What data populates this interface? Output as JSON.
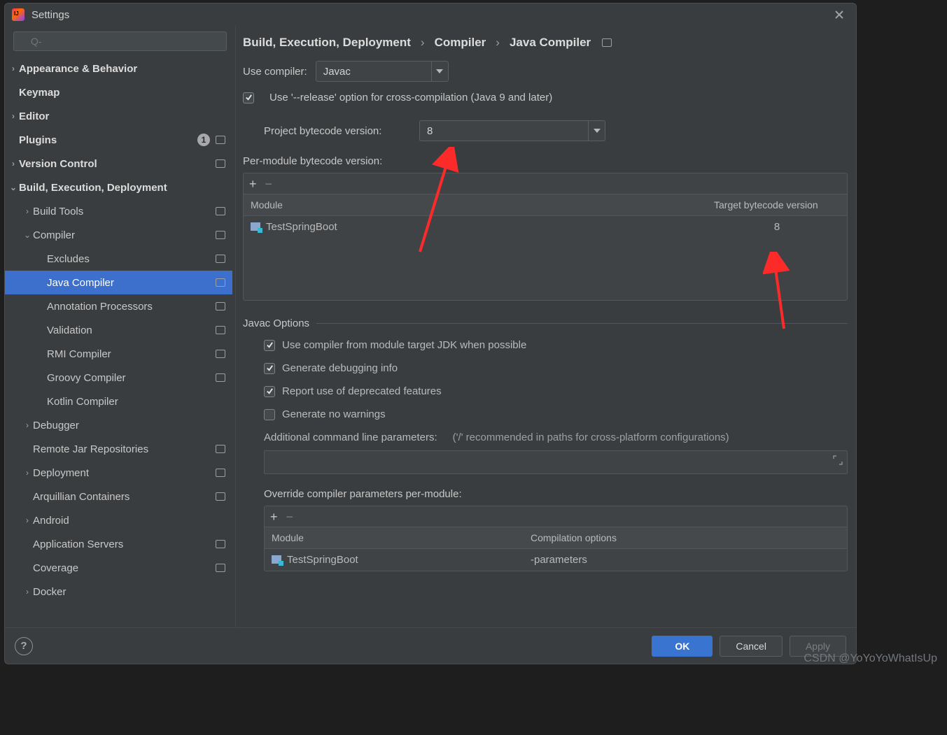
{
  "window": {
    "title": "Settings"
  },
  "search": {
    "placeholder": ""
  },
  "sidebar": {
    "items": [
      {
        "label": "Appearance & Behavior",
        "indent": 0,
        "bold": true,
        "arrow": "right",
        "badge": null
      },
      {
        "label": "Keymap",
        "indent": 0,
        "bold": true,
        "arrow": "",
        "badge": null
      },
      {
        "label": "Editor",
        "indent": 0,
        "bold": true,
        "arrow": "right",
        "badge": null
      },
      {
        "label": "Plugins",
        "indent": 0,
        "bold": true,
        "arrow": "",
        "badge": "1",
        "box": true
      },
      {
        "label": "Version Control",
        "indent": 0,
        "bold": true,
        "arrow": "right",
        "box": true
      },
      {
        "label": "Build, Execution, Deployment",
        "indent": 0,
        "bold": true,
        "arrow": "down"
      },
      {
        "label": "Build Tools",
        "indent": 1,
        "arrow": "right",
        "box": true
      },
      {
        "label": "Compiler",
        "indent": 1,
        "arrow": "down",
        "box": true
      },
      {
        "label": "Excludes",
        "indent": 2,
        "box": true
      },
      {
        "label": "Java Compiler",
        "indent": 2,
        "box": true,
        "selected": true
      },
      {
        "label": "Annotation Processors",
        "indent": 2,
        "box": true
      },
      {
        "label": "Validation",
        "indent": 2,
        "box": true
      },
      {
        "label": "RMI Compiler",
        "indent": 2,
        "box": true
      },
      {
        "label": "Groovy Compiler",
        "indent": 2,
        "box": true
      },
      {
        "label": "Kotlin Compiler",
        "indent": 2
      },
      {
        "label": "Debugger",
        "indent": 1,
        "arrow": "right"
      },
      {
        "label": "Remote Jar Repositories",
        "indent": 1,
        "box": true
      },
      {
        "label": "Deployment",
        "indent": 1,
        "arrow": "right",
        "box": true
      },
      {
        "label": "Arquillian Containers",
        "indent": 1,
        "box": true
      },
      {
        "label": "Android",
        "indent": 1,
        "arrow": "right"
      },
      {
        "label": "Application Servers",
        "indent": 1,
        "box": true
      },
      {
        "label": "Coverage",
        "indent": 1,
        "box": true
      },
      {
        "label": "Docker",
        "indent": 1,
        "arrow": "right"
      }
    ]
  },
  "crumbs": [
    "Build, Execution, Deployment",
    "Compiler",
    "Java Compiler"
  ],
  "form": {
    "useCompilerLabel": "Use compiler:",
    "useCompilerValue": "Javac",
    "releaseOption": "Use '--release' option for cross-compilation (Java 9 and later)",
    "pbvLabel": "Project bytecode version:",
    "pbvValue": "8",
    "perModuleLabel": "Per-module bytecode version:",
    "modHeader": "Module",
    "tgtHeader": "Target bytecode version",
    "perModuleRows": [
      {
        "module": "TestSpringBoot",
        "target": "8"
      }
    ],
    "javacOptionsTitle": "Javac Options",
    "opts": [
      {
        "text": "Use compiler from module target JDK when possible",
        "checked": true
      },
      {
        "text": "Generate debugging info",
        "checked": true
      },
      {
        "text": "Report use of deprecated features",
        "checked": true
      },
      {
        "text": "Generate no warnings",
        "checked": false
      }
    ],
    "addlParamsLabel": "Additional command line parameters:",
    "addlParamsHint": "('/' recommended in paths for cross-platform configurations)",
    "overrideLabel": "Override compiler parameters per-module:",
    "ovHeaderMod": "Module",
    "ovHeaderOpt": "Compilation options",
    "overrideRows": [
      {
        "module": "TestSpringBoot",
        "options": "-parameters"
      }
    ]
  },
  "footer": {
    "ok": "OK",
    "cancel": "Cancel",
    "apply": "Apply"
  },
  "watermark": "CSDN @YoYoYoWhatIsUp"
}
